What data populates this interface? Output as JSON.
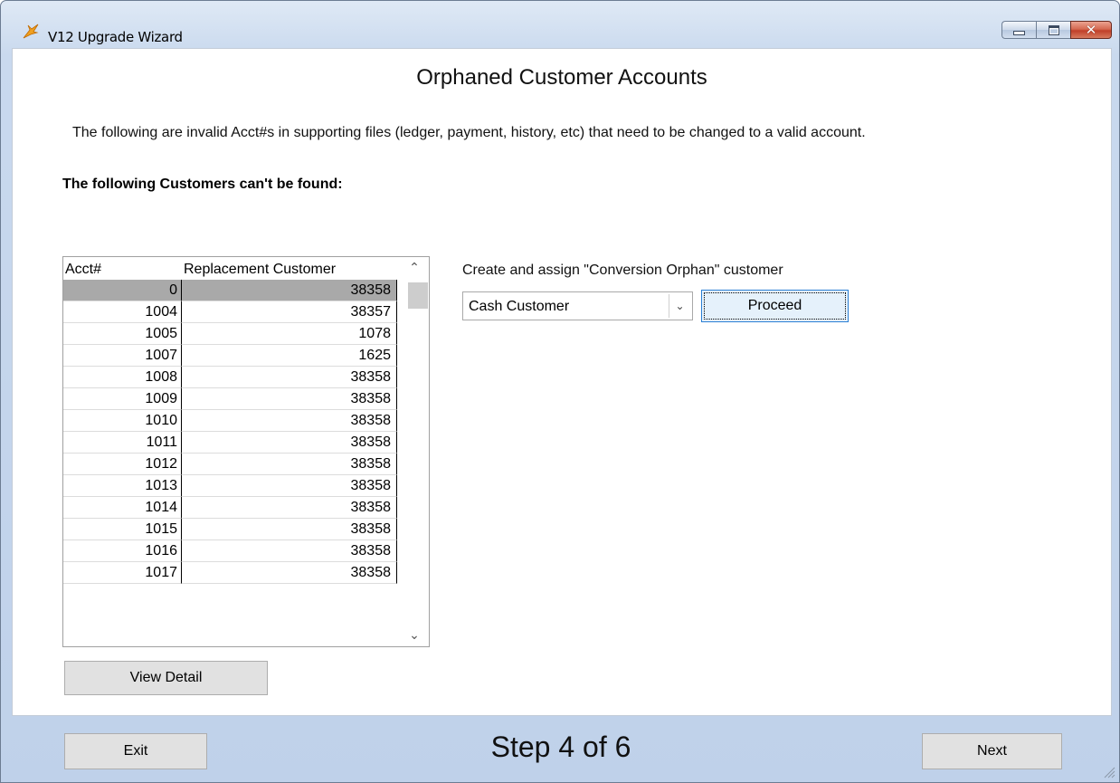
{
  "window": {
    "title": "V12 Upgrade Wizard",
    "controls": [
      "minimize",
      "maximize",
      "close"
    ]
  },
  "page": {
    "heading": "Orphaned Customer Accounts",
    "description": "The following are invalid Acct#s in supporting files (ledger, payment, history, etc) that need to be changed to a valid account.",
    "subheading": "The following Customers can't be found:"
  },
  "grid": {
    "columns": [
      "Acct#",
      "Replacement Customer"
    ],
    "selected_row": 0,
    "rows": [
      {
        "acct": "0",
        "replacement": "38358"
      },
      {
        "acct": "1004",
        "replacement": "38357"
      },
      {
        "acct": "1005",
        "replacement": "1078"
      },
      {
        "acct": "1007",
        "replacement": "1625"
      },
      {
        "acct": "1008",
        "replacement": "38358"
      },
      {
        "acct": "1009",
        "replacement": "38358"
      },
      {
        "acct": "1010",
        "replacement": "38358"
      },
      {
        "acct": "1011",
        "replacement": "38358"
      },
      {
        "acct": "1012",
        "replacement": "38358"
      },
      {
        "acct": "1013",
        "replacement": "38358"
      },
      {
        "acct": "1014",
        "replacement": "38358"
      },
      {
        "acct": "1015",
        "replacement": "38358"
      },
      {
        "acct": "1016",
        "replacement": "38358"
      },
      {
        "acct": "1017",
        "replacement": "38358"
      }
    ]
  },
  "actions": {
    "view_detail": "View Detail",
    "orphan_label": "Create and assign \"Conversion Orphan\" customer",
    "customer_select_value": "Cash Customer",
    "proceed": "Proceed"
  },
  "footer": {
    "exit": "Exit",
    "step": "Step 4 of 6",
    "next": "Next"
  },
  "colors": {
    "selected_row": "#a9a9a9",
    "focus_border": "#2a7fd4",
    "frame": "#c9d9ee",
    "close_button": "#c0402a"
  }
}
